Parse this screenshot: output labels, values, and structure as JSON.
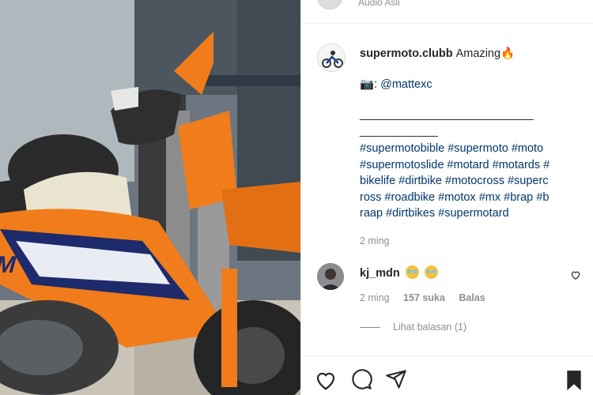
{
  "header": {
    "audio_label": "Audio Asli"
  },
  "post": {
    "username": "supermoto.clubb",
    "caption_lines": [
      "Amazing🔥",
      "📷: @mattexc",
      "_____________________________",
      "_____________",
      "#supermotobible #supermoto #moto",
      "#supermotoslide #motard #motards #",
      "bikelife #dirtbike #motocross #superc",
      "ross #roadbike #motox #mx #brap #b",
      "raap #dirtbikes #supermotard"
    ],
    "camera_prefix": "📷: ",
    "mention": "@mattexc",
    "time": "2 ming"
  },
  "comment": {
    "username": "kj_mdn",
    "time": "2 ming",
    "likes": "157 suka",
    "reply": "Balas",
    "view_replies": "Lihat balasan (1)"
  },
  "icons": {
    "like": "heart-icon",
    "comment": "comment-icon",
    "share": "share-icon",
    "save": "bookmark-icon",
    "comment_like": "heart-icon"
  },
  "colors": {
    "link": "#00376b",
    "muted": "#8e8e8e",
    "text": "#262626",
    "bike_orange": "#f07c1b"
  }
}
